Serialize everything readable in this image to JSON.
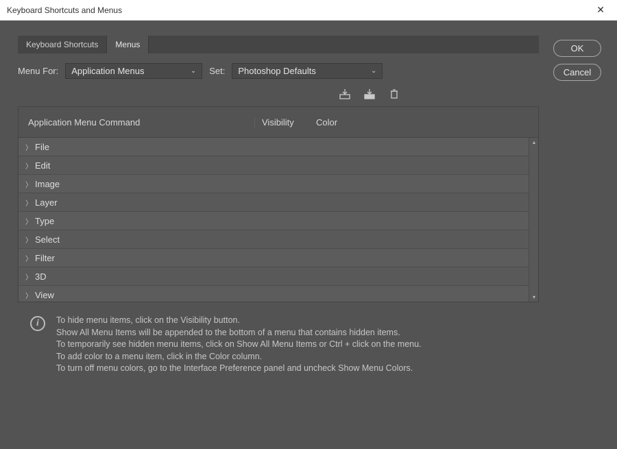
{
  "window": {
    "title": "Keyboard Shortcuts and Menus"
  },
  "tabs": {
    "shortcuts": "Keyboard Shortcuts",
    "menus": "Menus"
  },
  "controls": {
    "menuForLabel": "Menu For:",
    "menuForValue": "Application Menus",
    "setLabel": "Set:",
    "setValue": "Photoshop Defaults"
  },
  "headers": {
    "command": "Application Menu Command",
    "visibility": "Visibility",
    "color": "Color"
  },
  "menuItems": [
    "File",
    "Edit",
    "Image",
    "Layer",
    "Type",
    "Select",
    "Filter",
    "3D",
    "View"
  ],
  "info": {
    "l1": "To hide menu items, click on the Visibility button.",
    "l2": "Show All Menu Items will be appended to the bottom of a menu that contains hidden items.",
    "l3": "To temporarily see hidden menu items, click on Show All Menu Items or Ctrl + click on the menu.",
    "l4": "To add color to a menu item, click in the Color column.",
    "l5": "To turn off menu colors, go to the Interface Preference panel and uncheck Show Menu Colors."
  },
  "buttons": {
    "ok": "OK",
    "cancel": "Cancel"
  }
}
